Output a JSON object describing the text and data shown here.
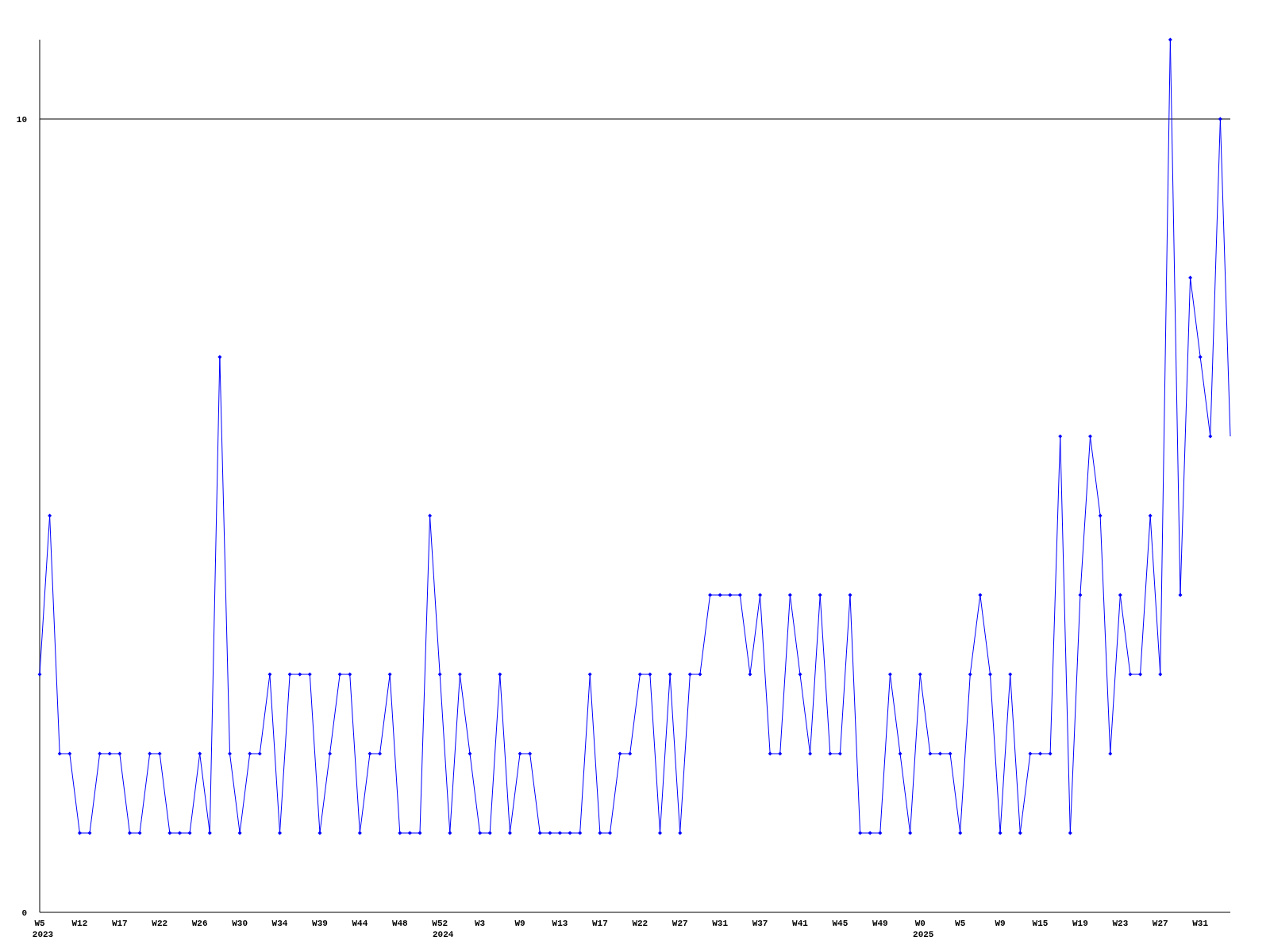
{
  "chart_data": {
    "type": "line",
    "ylim": [
      0,
      11
    ],
    "yticks": [
      0,
      10
    ],
    "categories": [
      "W5\n2023",
      null,
      null,
      null,
      "W12",
      null,
      null,
      null,
      "W17",
      null,
      null,
      null,
      "W22",
      null,
      null,
      null,
      "W26",
      null,
      null,
      null,
      "W30",
      null,
      null,
      null,
      "W34",
      null,
      null,
      null,
      "W39",
      null,
      null,
      null,
      "W44",
      null,
      null,
      null,
      "W48",
      null,
      null,
      null,
      "W52\n2024",
      null,
      null,
      null,
      "W3",
      null,
      null,
      null,
      "W9",
      null,
      null,
      null,
      "W13",
      null,
      null,
      null,
      "W17",
      null,
      null,
      null,
      "W22",
      null,
      null,
      null,
      "W27",
      null,
      null,
      null,
      "W31",
      null,
      null,
      null,
      "W37",
      null,
      null,
      null,
      "W41",
      null,
      null,
      null,
      "W45",
      null,
      null,
      null,
      "W49",
      null,
      null,
      null,
      "W0\n2025",
      null,
      null,
      null,
      "W5",
      null,
      null,
      null,
      "W9",
      null,
      null,
      null,
      "W15",
      null,
      null,
      null,
      "W19",
      null,
      null,
      null,
      "W23",
      null,
      null,
      null,
      "W27",
      null,
      null,
      null,
      "W31",
      null,
      null,
      null
    ],
    "series": [
      {
        "color": "#0000ff",
        "marker": true,
        "values": [
          3,
          5,
          2,
          2,
          1,
          1,
          2,
          2,
          2,
          1,
          1,
          2,
          2,
          1,
          1,
          1,
          2,
          1,
          7,
          2,
          1,
          2,
          2,
          3,
          1,
          3,
          3,
          3,
          1,
          2,
          3,
          3,
          1,
          2,
          2,
          3,
          1,
          1,
          1,
          5,
          3,
          1,
          3,
          2,
          1,
          1,
          3,
          1,
          2,
          2,
          1,
          1,
          1,
          1,
          1,
          3,
          1,
          1,
          2,
          2,
          3,
          3,
          1,
          3,
          1,
          3,
          3,
          4,
          4,
          4,
          4,
          3,
          4,
          2,
          2,
          4,
          3,
          2,
          4,
          2,
          2,
          4,
          1,
          1,
          1,
          3,
          2,
          1,
          3,
          2,
          2,
          2,
          1,
          3,
          4,
          3,
          1,
          3,
          1,
          2,
          2,
          2,
          6,
          1,
          4,
          6,
          5,
          2,
          4,
          3,
          3,
          5,
          3,
          11,
          4,
          8,
          7,
          6,
          10,
          6
        ]
      }
    ]
  }
}
